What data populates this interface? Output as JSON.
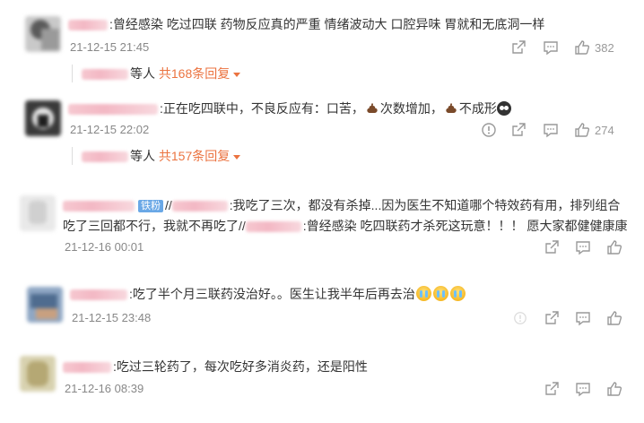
{
  "comments": [
    {
      "text": ":曾经感染 吃过四联 药物反应真的严重 情绪波动大 口腔异味 胃就和无底洞一样",
      "time": "21-12-15 21:45",
      "likes": "382",
      "replies": {
        "suffix": "等人",
        "count": "共168条回复"
      }
    },
    {
      "text_a": ":正在吃四联中，不良反应有：口苦，",
      "text_b": "次数增加，",
      "text_c": "不成形",
      "time": "21-12-15 22:02",
      "likes": "274",
      "replies": {
        "suffix": "等人",
        "count": "共157条回复"
      }
    },
    {
      "badge": "铁粉",
      "text_a": "//",
      "text_b": ":我吃了三次，都没有杀掉...因为医生不知道哪个特效药有用，排列组合",
      "text_c": "吃了三回都不行，我就不再吃了//",
      "text_d": ":曾经感染 吃四联药才杀死这玩意！！！ 愿大家都健健康康",
      "time": "21-12-16 00:01"
    },
    {
      "text": ":吃了半个月三联药没治好。。医生让我半年后再去治",
      "time": "21-12-15 23:48"
    },
    {
      "text": ":吃过三轮药了，每次吃好多消炎药，还是阳性",
      "time": "21-12-16 08:39"
    }
  ],
  "icons": {
    "share": "share-icon",
    "comment": "comment-icon",
    "like": "like-icon",
    "report": "report-icon"
  },
  "colors": {
    "accent": "#eb7340",
    "time": "#888888",
    "icon": "#999999"
  }
}
